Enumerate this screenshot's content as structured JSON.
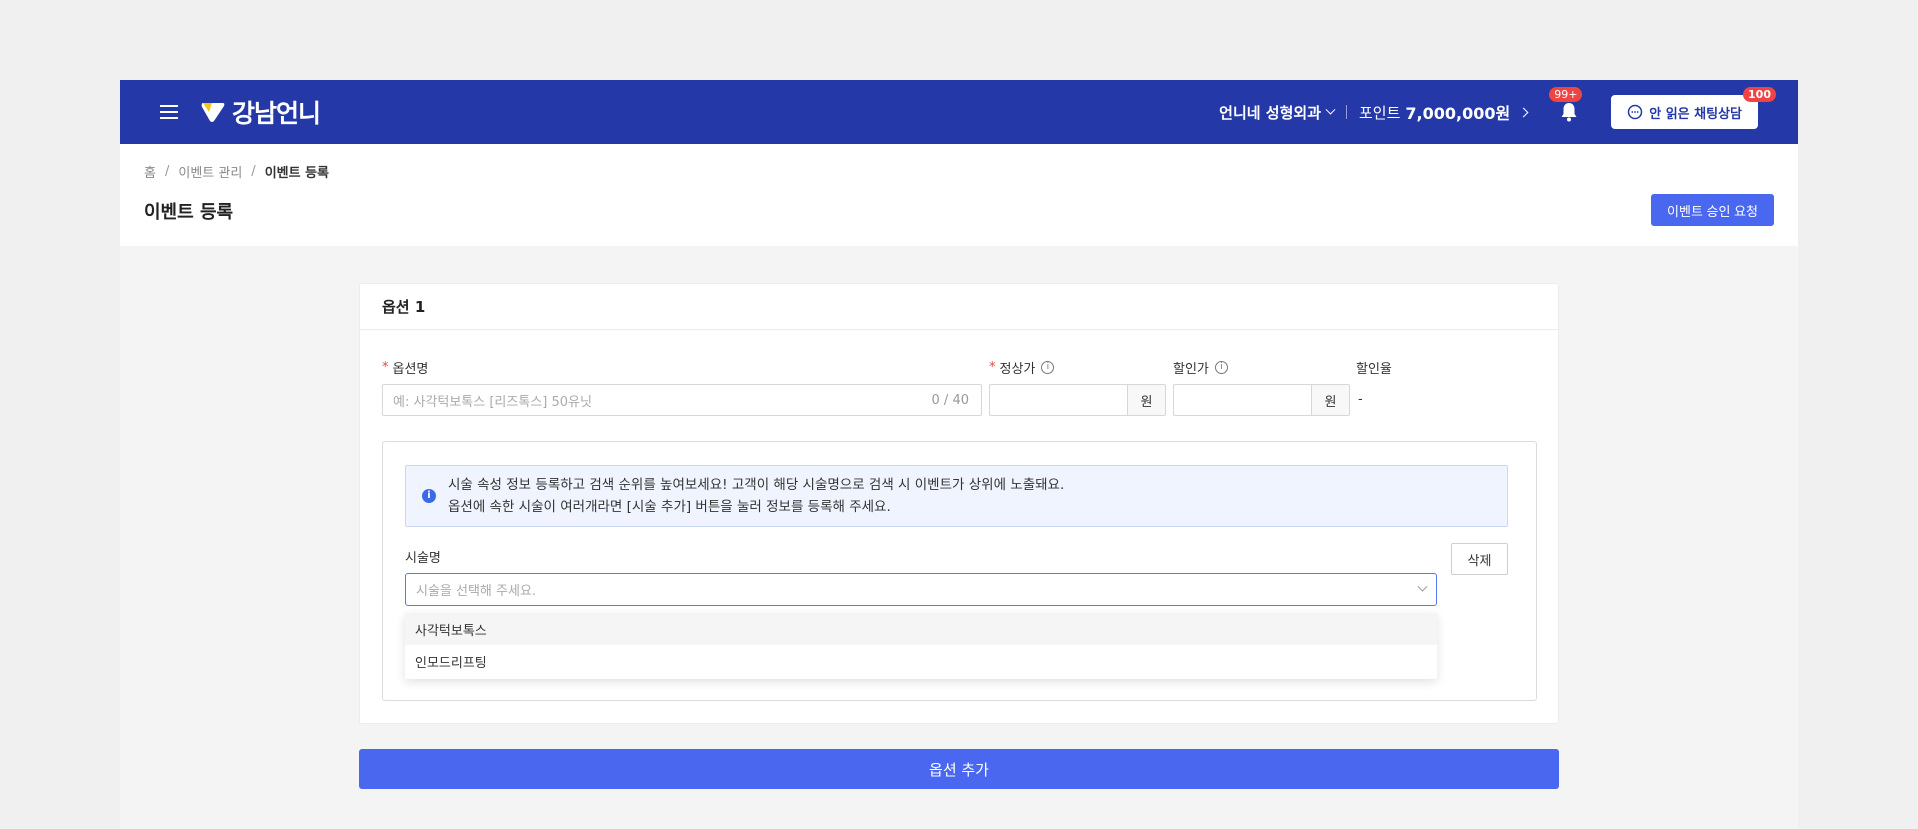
{
  "topbar": {
    "logo_text": "강남언니",
    "clinic_name": "언니네 성형외과",
    "points_label": "포인트",
    "points_amount": "7,000,000원",
    "notifications_badge": "99+",
    "chat_button_label": "안 읽은 채팅상담",
    "chat_badge": "100",
    "brand_color": "#2438a8"
  },
  "breadcrumb": [
    "홈",
    "이벤트 관리",
    "이벤트 등록"
  ],
  "page": {
    "title": "이벤트 등록",
    "approve_button": "이벤트 승인 요청",
    "accent_color": "#4a67f0"
  },
  "option": {
    "header": "옵션 1",
    "name_label": "옵션명",
    "name_placeholder": "예: 사각턱보톡스 [리즈톡스] 50유닛",
    "name_counter": "0 / 40",
    "regular_price_label": "정상가",
    "sale_price_label": "할인가",
    "currency_unit": "원",
    "discount_rate_label": "할인율",
    "discount_rate_value": "-",
    "notice_line1": "시술 속성 정보 등록하고 검색 순위를 높여보세요! 고객이 해당 시술명으로 검색 시 이벤트가 상위에 노출돼요.",
    "notice_line2": "옵션에 속한 시술이 여러개라면 [시술 추가] 버튼을 눌러 정보를 등록해 주세요.",
    "procedure_label": "시술명",
    "procedure_placeholder": "시술을 선택해 주세요.",
    "delete_button": "삭제",
    "dropdown_options": [
      "사각턱보톡스",
      "인모드리프팅"
    ]
  },
  "add_option_button": "옵션 추가"
}
